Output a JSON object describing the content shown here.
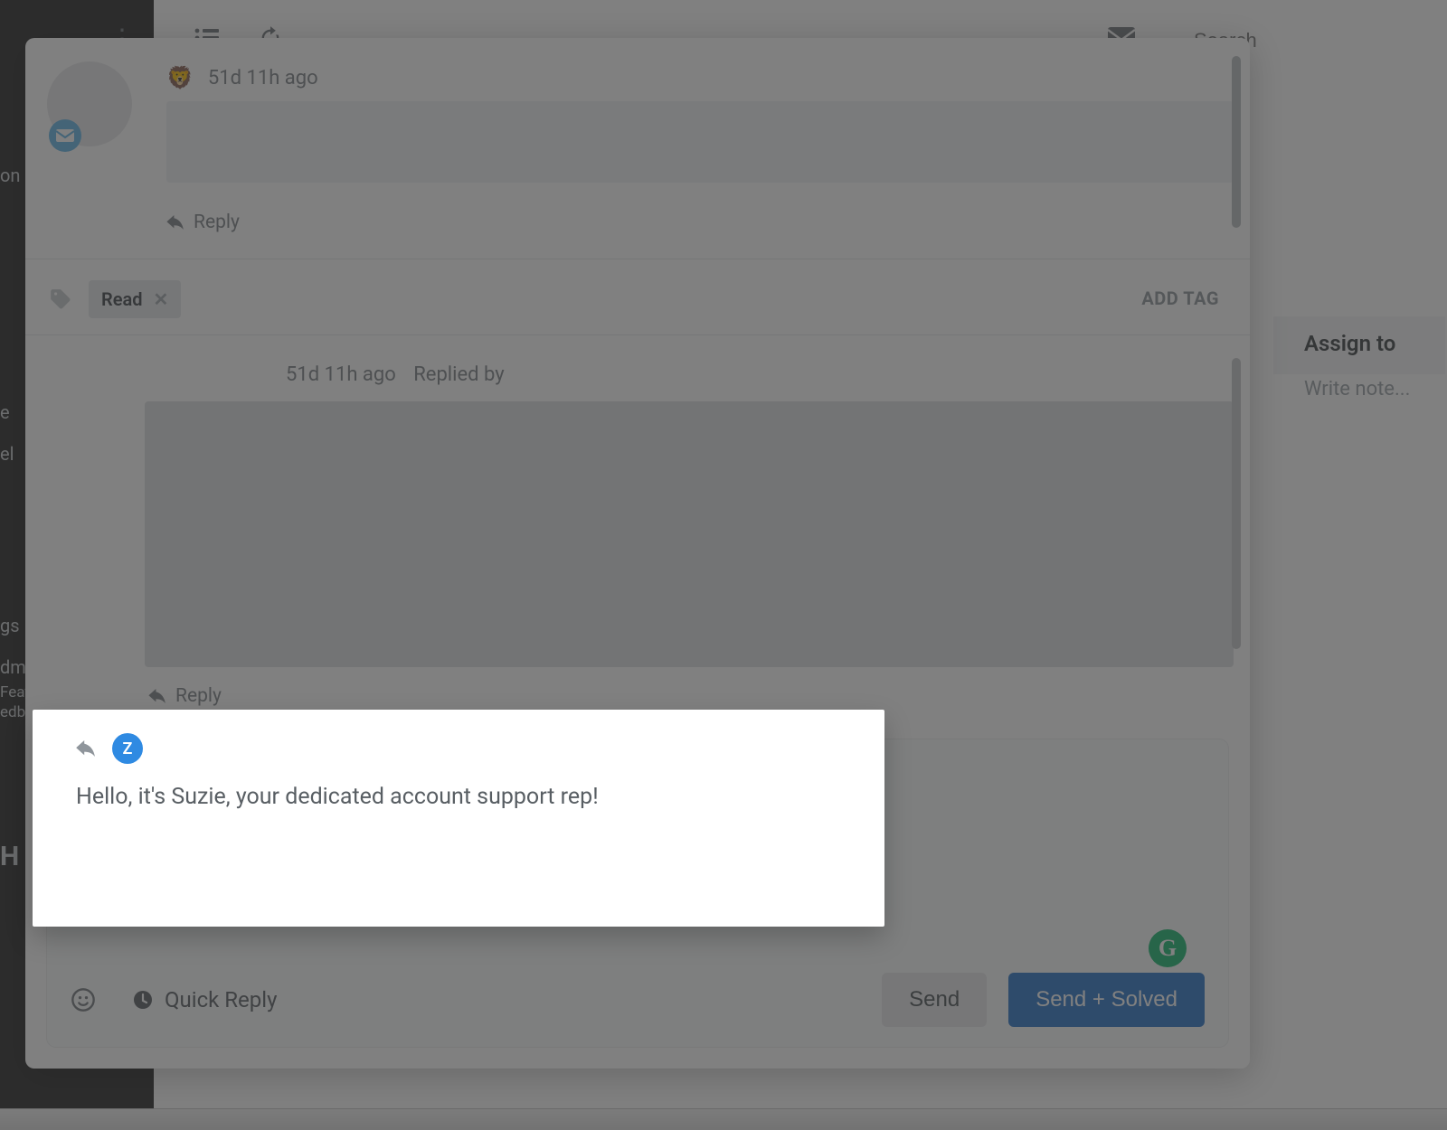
{
  "toolbar": {
    "search_placeholder": "Search"
  },
  "thread": {
    "msg1": {
      "timestamp": "51d 11h ago",
      "reply_label": "Reply"
    },
    "tags": {
      "chip": "Read",
      "add_label": "ADD TAG"
    },
    "msg2": {
      "timestamp": "51d 11h ago",
      "replied_by_label": "Replied by",
      "reply_label": "Reply"
    }
  },
  "composer": {
    "avatar_initial": "Z",
    "text": "Hello, it's Suzie, your dedicated account support rep!",
    "quick_reply_label": "Quick Reply",
    "send_label": "Send",
    "send_solved_label": "Send + Solved"
  },
  "sidebar_right": {
    "assign_label": "Assign to",
    "note_placeholder": "Write note..."
  },
  "left_fragments": {
    "a": "on l",
    "b": "e",
    "c": "el",
    "d": "gs",
    "e": "dm",
    "f": "Feat",
    "g": "edb",
    "h": "H"
  }
}
